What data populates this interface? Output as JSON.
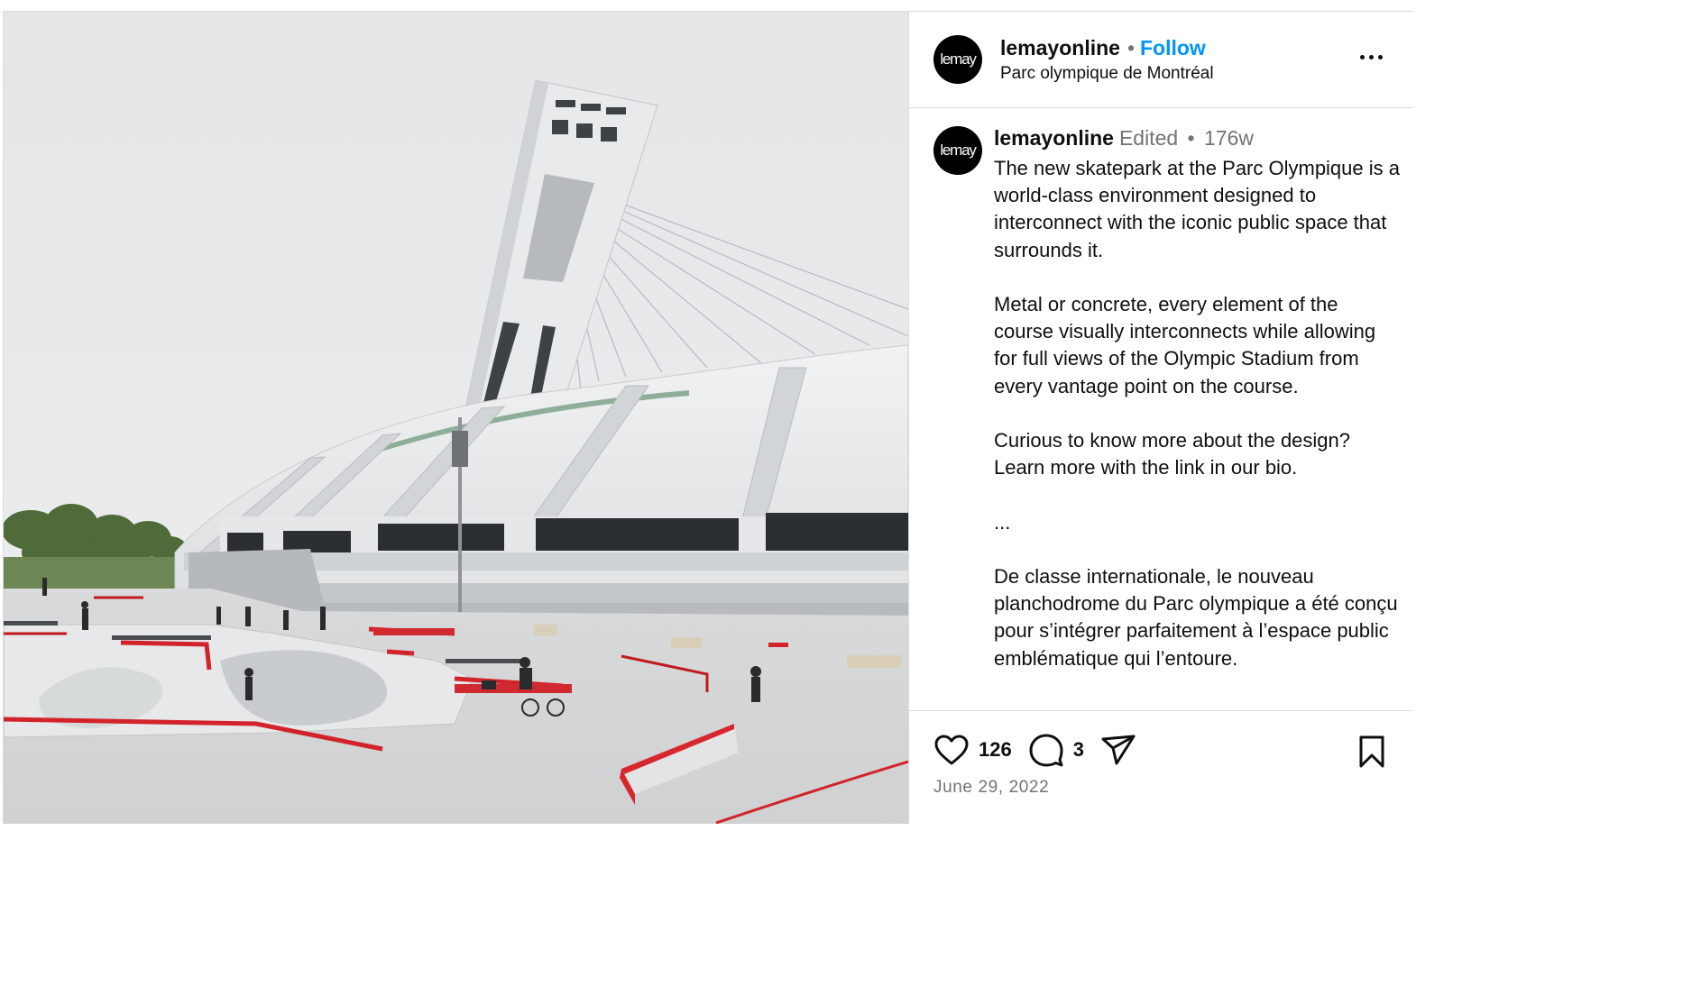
{
  "post": {
    "photo_alt": "Skatepark in front of the Montreal Olympic Stadium and inclined tower",
    "author": {
      "username": "lemayonline",
      "avatar_text": "lemay"
    },
    "header": {
      "separator": "•",
      "follow_label": "Follow",
      "location": "Parc olympique de Montréal"
    },
    "caption": {
      "username": "lemayonline",
      "edited_label": "Edited",
      "separator": "•",
      "time": "176w",
      "paragraphs": [
        "The new skatepark at the Parc Olympique is a world-class environment designed to interconnect with the iconic public space that surrounds it.",
        "Metal or concrete, every element of the course visually interconnects while allowing for full views of the Olympic Stadium from every vantage point on the course.",
        "Curious to know more about the design? Learn more with the link in our bio.",
        "...",
        "De classe internationale, le nouveau planchodrome du Parc olympique a été conçu pour s’intégrer parfaitement à l’espace public emblématique qui l’entoure."
      ]
    },
    "actions": {
      "like_icon": "heart-icon",
      "likes": "126",
      "comment_icon": "comment-icon",
      "comments": "3",
      "share_icon": "share-icon",
      "save_icon": "bookmark-icon"
    },
    "date": "June 29, 2022"
  },
  "colors": {
    "accent": "#0095f6",
    "muted": "#737373",
    "border": "#dbdbdb"
  }
}
